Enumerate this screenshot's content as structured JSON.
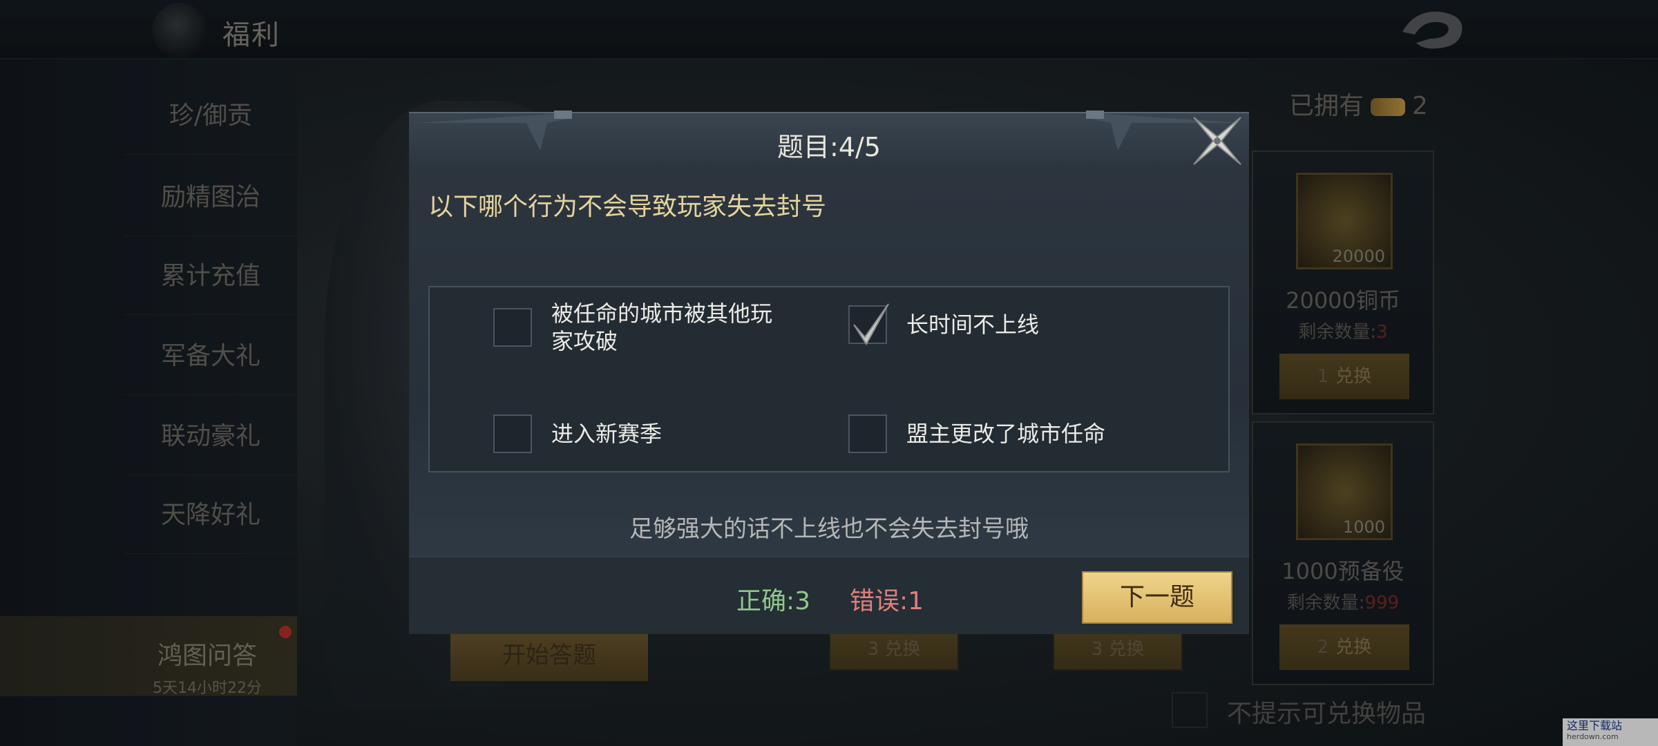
{
  "header": {
    "title": "福利",
    "logo_icon": "dragon-emblem-icon",
    "back_icon": "dragon-back-icon"
  },
  "sidebar": {
    "items": [
      {
        "label": "珍/御贡"
      },
      {
        "label": "励精图治"
      },
      {
        "label": "累计充值"
      },
      {
        "label": "军备大礼"
      },
      {
        "label": "联动豪礼"
      },
      {
        "label": "天降好礼"
      },
      {
        "label": "鸿图问答",
        "sub": "5天14小时22分",
        "active": true,
        "has_badge": true
      }
    ]
  },
  "shop": {
    "owned_label": "已拥有",
    "owned_count": "2",
    "rewards": [
      {
        "qty": "20000",
        "name": "20000铜币",
        "remain_label": "剩余数量:",
        "remain": "3",
        "cost": "1",
        "btn": "兑换"
      },
      {
        "qty": "1000",
        "name": "1000预备役",
        "remain_label": "剩余数量:",
        "remain": "999",
        "cost": "2",
        "btn": "兑换"
      }
    ],
    "bottom_buttons": [
      {
        "cost": "3",
        "btn": "兑换"
      },
      {
        "cost": "3",
        "btn": "兑换"
      }
    ],
    "start_button": "开始答题",
    "hide_option": "不提示可兑换物品"
  },
  "quiz": {
    "title": "题目:4/5",
    "question": "以下哪个行为不会导致玩家失去封号",
    "options": [
      {
        "text": "被任命的城市被其他玩家攻破",
        "line1": "被任命的城市被其他玩",
        "line2": "家攻破",
        "checked": false
      },
      {
        "text": "长时间不上线",
        "checked": true
      },
      {
        "text": "进入新赛季",
        "checked": false
      },
      {
        "text": "盟主更改了城市任命",
        "checked": false
      }
    ],
    "hint": "足够强大的话不上线也不会失去封号哦",
    "correct_label": "正确:3",
    "wrong_label": "错误:1",
    "next_button": "下一题",
    "close_icon": "crossed-blades-close-icon"
  },
  "watermark": {
    "title": "这里下载站",
    "url": "herdown.com"
  },
  "colors": {
    "accent_gold": "#e6d49c",
    "correct_green": "#8fc98a",
    "wrong_red": "#e07f7a",
    "button_gold": "#d8b15e"
  }
}
